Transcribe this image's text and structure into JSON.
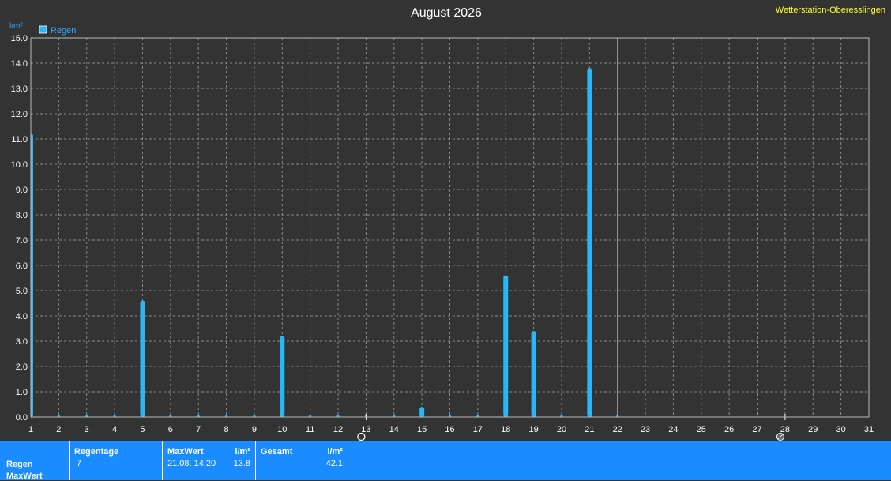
{
  "title": "August 2026",
  "station": "Wetterstation-Oberesslingen",
  "colors": {
    "background": "#333333",
    "bar": "#29b6f6",
    "grid": "#8a8a8a",
    "panel": "#1a8cff",
    "station": "#ffff33"
  },
  "chart_data": {
    "type": "bar",
    "title": "August 2026",
    "xlabel": "",
    "ylabel": "l/m²",
    "ylim": [
      0,
      15
    ],
    "yticks": [
      "0.0",
      "1.0",
      "2.0",
      "3.0",
      "4.0",
      "5.0",
      "6.0",
      "7.0",
      "8.0",
      "9.0",
      "10.0",
      "11.0",
      "12.0",
      "13.0",
      "14.0",
      "15.0"
    ],
    "categories": [
      "1",
      "2",
      "3",
      "4",
      "5",
      "6",
      "7",
      "8",
      "9",
      "10",
      "11",
      "12",
      "13",
      "14",
      "15",
      "16",
      "17",
      "18",
      "19",
      "20",
      "21",
      "22",
      "23",
      "24",
      "25",
      "26",
      "27",
      "28",
      "29",
      "30",
      "31"
    ],
    "series": [
      {
        "name": "Regen",
        "values": [
          11.2,
          0.0,
          0.0,
          0.0,
          4.6,
          0.0,
          0.0,
          0.0,
          0.0,
          3.2,
          0.0,
          0.0,
          0.0,
          0.0,
          0.4,
          0.0,
          0.0,
          5.6,
          3.4,
          0.0,
          13.8,
          0.0,
          null,
          null,
          null,
          null,
          null,
          null,
          null,
          null,
          null
        ]
      }
    ],
    "moon_phases": [
      {
        "day": 13,
        "phase": "full-moon"
      },
      {
        "day": 28,
        "phase": "new-moon"
      }
    ],
    "current_day": 22,
    "grid": true,
    "legend": "top-left"
  },
  "stats": {
    "row_label_1": "Regen",
    "row_label_2": "MaxWert",
    "regentage_label": "Regentage",
    "regentage_value": "7",
    "maxwert_label": "MaxWert",
    "maxwert_unit": "l/m²",
    "maxwert_date": "21.08.  14:20",
    "maxwert_value": "13.8",
    "gesamt_label": "Gesamt",
    "gesamt_unit": "l/m²",
    "gesamt_value": "42.1"
  }
}
